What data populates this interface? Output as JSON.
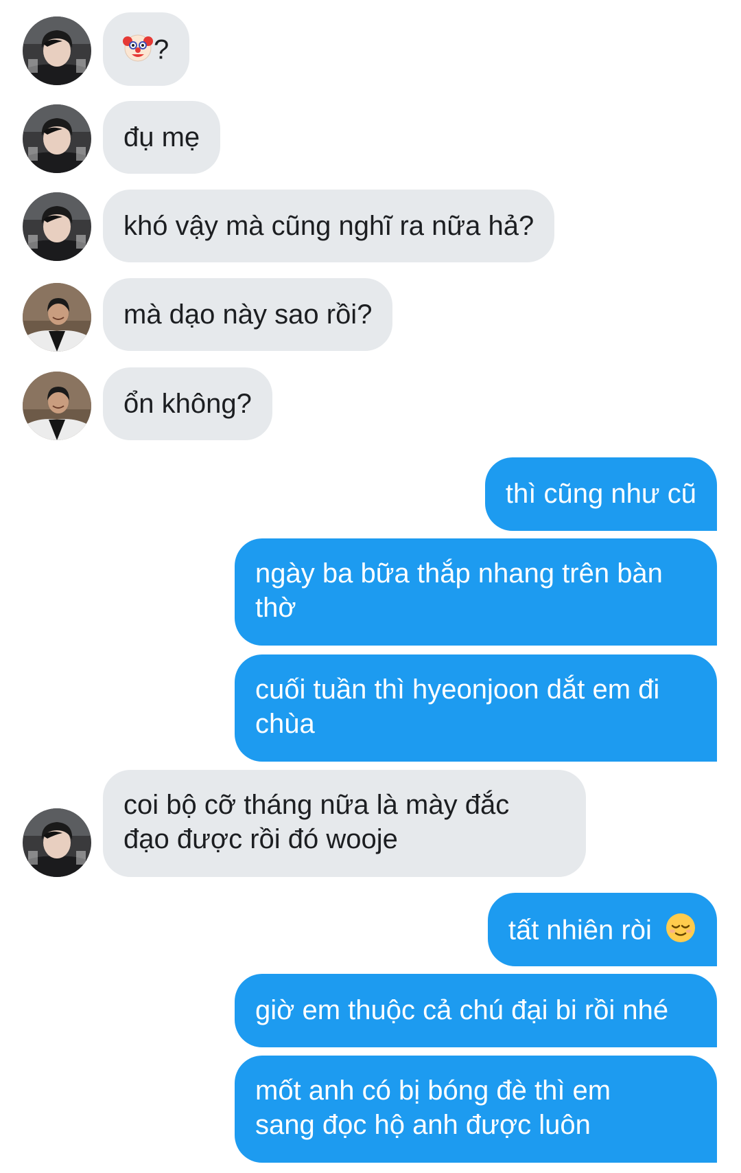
{
  "colors": {
    "incoming_bubble": "#e6e9ec",
    "outgoing_bubble": "#1d9bf0",
    "incoming_text": "#1c1e21",
    "outgoing_text": "#ffffff"
  },
  "messages": [
    {
      "direction": "incoming",
      "avatar": "avatar-a",
      "emoji": "clown-face",
      "text": "?"
    },
    {
      "direction": "incoming",
      "avatar": "avatar-a",
      "text": "đụ mẹ"
    },
    {
      "direction": "incoming",
      "avatar": "avatar-a",
      "text": "khó vậy mà cũng nghĩ ra nữa hả?"
    },
    {
      "direction": "incoming",
      "avatar": "avatar-b",
      "text": "mà dạo này sao rồi?"
    },
    {
      "direction": "incoming",
      "avatar": "avatar-b",
      "text": "ổn không?"
    },
    {
      "direction": "outgoing",
      "text": "thì cũng như cũ"
    },
    {
      "direction": "outgoing",
      "lines": [
        "ngày ba bữa thắp nhang trên bàn",
        "thờ"
      ]
    },
    {
      "direction": "outgoing",
      "lines": [
        "cuối tuần thì hyeonjoon dắt em đi",
        "chùa"
      ]
    },
    {
      "direction": "incoming",
      "avatar": "avatar-a",
      "lines": [
        "coi bộ cỡ tháng nữa là mày đắc",
        "đạo được rồi đó wooje"
      ]
    },
    {
      "direction": "outgoing",
      "text": "tất nhiên ròi",
      "emoji": "relieved-face"
    },
    {
      "direction": "outgoing",
      "text": "giờ em thuộc cả chú đại bi rồi nhé"
    },
    {
      "direction": "outgoing",
      "lines": [
        "mốt anh có bị bóng đè thì em",
        "sang đọc hộ anh được luôn"
      ]
    }
  ]
}
